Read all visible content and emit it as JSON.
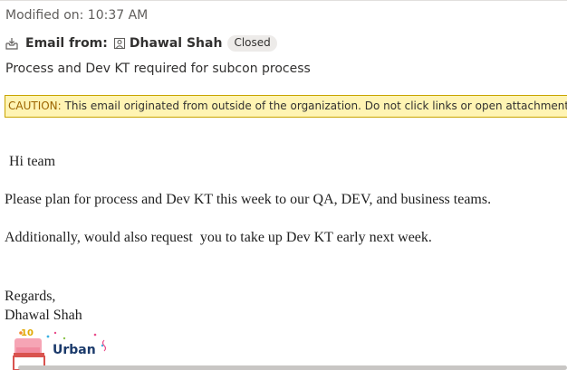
{
  "header": {
    "modified_text": "Modified on: 10:37 AM",
    "email_from_label": "Email from:",
    "sender_name": "Dhawal Shah",
    "status": "Closed",
    "subject": "Process and Dev KT required for subcon process"
  },
  "caution": {
    "label": "CAUTION:",
    "text": " This email originated from outside of the organization. Do not click links or open attachments unless you recognize the sender and know the content is safe."
  },
  "body": {
    "greeting": "Hi team",
    "paragraph1": "Please plan for process and Dev KT this week to our QA, DEV, and business teams.",
    "paragraph2": "Additionally, would also request  you to take up Dev KT early next week.",
    "regards": "Regards,",
    "signer": "Dhawal Shah"
  },
  "logo": {
    "text": "Urban",
    "badge_number": "10"
  },
  "colors": {
    "caution_background": "#fff4b3",
    "caution_border": "#c8a400",
    "caution_label": "#9c6500",
    "badge_background": "#edebe9"
  },
  "icons": {
    "inbox": "inbox-arrow-icon",
    "contact": "contact-card-icon"
  }
}
